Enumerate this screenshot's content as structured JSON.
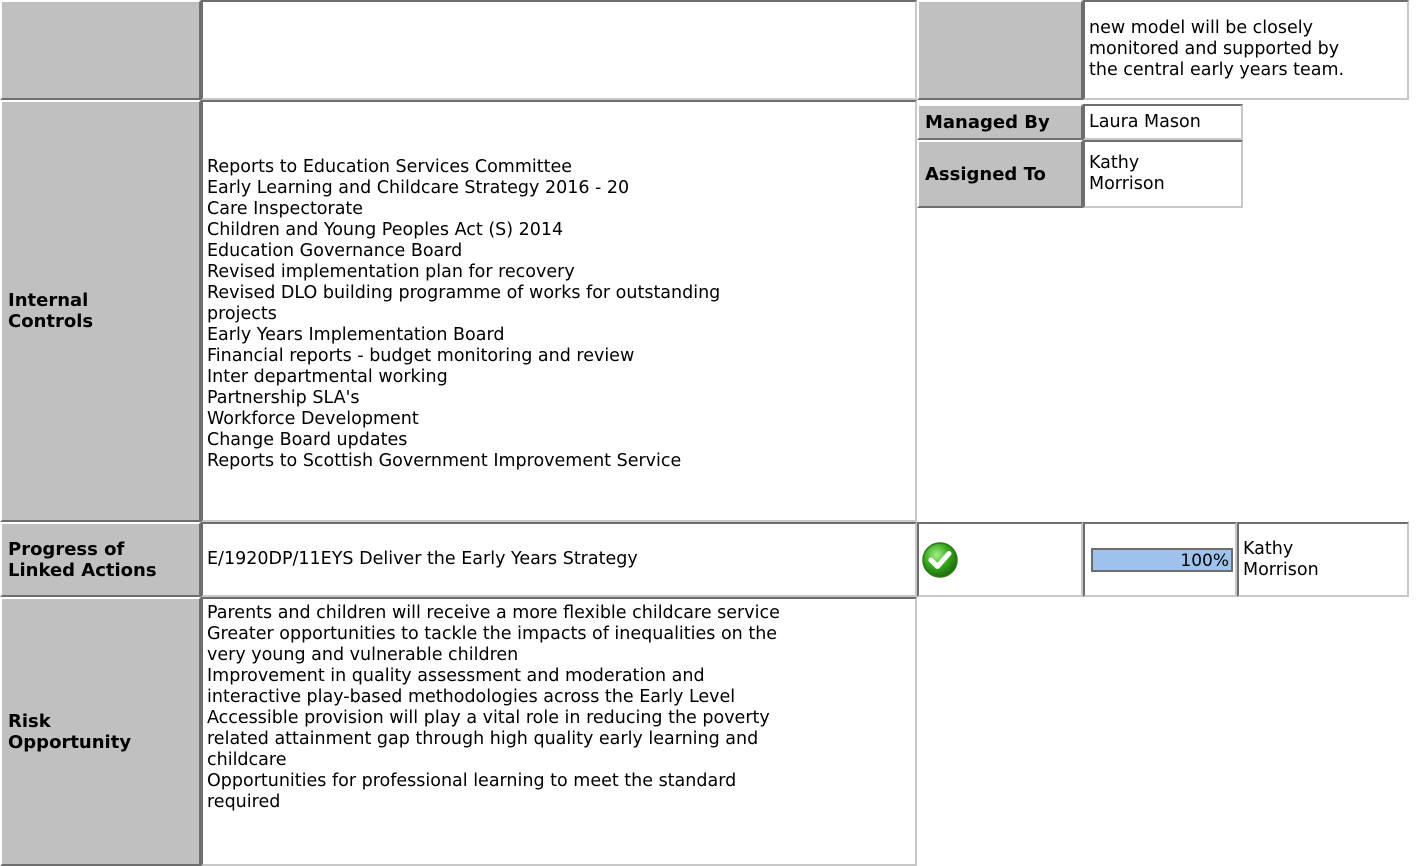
{
  "top_row": {
    "lines": [
      "new model will be closely",
      "monitored and supported by",
      "the central early years team."
    ]
  },
  "internal_controls": {
    "label_lines": [
      "Internal",
      "Controls"
    ],
    "items": [
      "Reports to Education Services Committee",
      "Early Learning and Childcare Strategy 2016 - 20",
      "Care Inspectorate",
      "Children and Young Peoples Act (S) 2014",
      "Education Governance Board",
      "Revised implementation plan for recovery",
      "Revised DLO building programme of works for outstanding",
      "projects",
      "Early Years Implementation Board",
      "Financial reports - budget monitoring and review",
      "Inter departmental working",
      "Partnership SLA's",
      "Workforce Development",
      "Change Board updates",
      "Reports to Scottish Government Improvement Service"
    ],
    "managed_by_label": "Managed By",
    "managed_by_value": "Laura Mason",
    "assigned_to_label": "Assigned To",
    "assigned_to_lines": [
      "Kathy",
      "Morrison"
    ]
  },
  "linked_actions": {
    "label_lines": [
      "Progress of",
      "Linked Actions"
    ],
    "action": "E/1920DP/11EYS Deliver the Early Years Strategy",
    "status_icon": "green-check-icon",
    "progress_percent": 100,
    "progress_text": "100%",
    "owner_lines": [
      "Kathy",
      "Morrison"
    ]
  },
  "risk_opportunity": {
    "label_lines": [
      "Risk",
      "Opportunity"
    ],
    "lines": [
      "Parents and children will receive a more flexible childcare service",
      "Greater opportunities to tackle the impacts of inequalities on the",
      "very young and vulnerable children",
      "Improvement in quality assessment and moderation and",
      "interactive play-based methodologies across the Early Level",
      "Accessible provision will play a vital role in reducing the poverty",
      "related attainment gap through high quality early learning and",
      "childcare",
      "Opportunities for professional learning to meet the standard",
      "required"
    ]
  },
  "colors": {
    "header_grey": "#c0c0c0",
    "progress_fill": "#9ec2ec",
    "check_green": "#3aa81e"
  }
}
